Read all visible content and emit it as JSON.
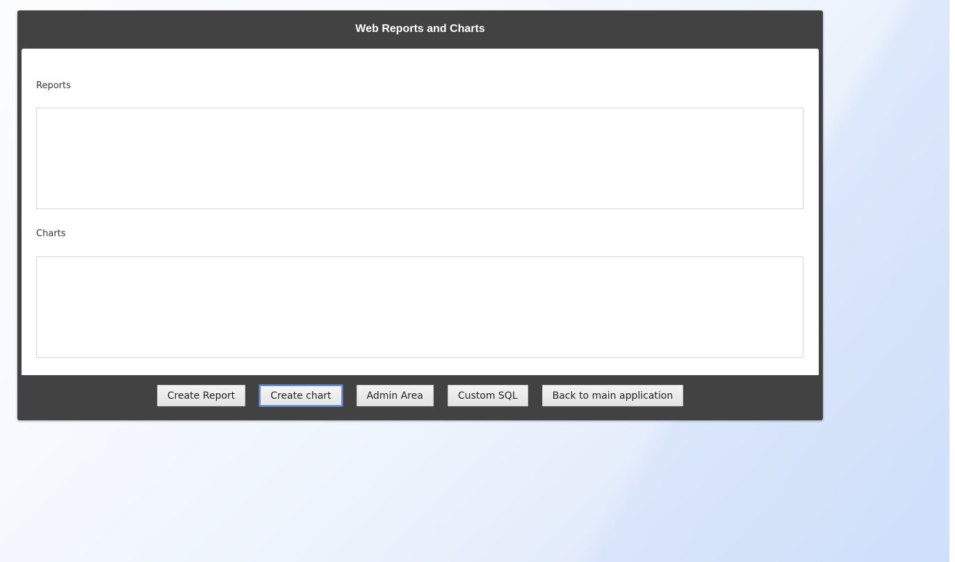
{
  "header": {
    "title": "Web Reports and Charts"
  },
  "sections": {
    "reports_label": "Reports",
    "charts_label": "Charts"
  },
  "buttons": {
    "create_report": "Create Report",
    "create_chart": "Create chart",
    "admin_area": "Admin Area",
    "custom_sql": "Custom SQL",
    "back_to_main": "Back to main application"
  },
  "colors": {
    "panel_dark": "#424242",
    "focus_outline": "#6a8fd0"
  }
}
